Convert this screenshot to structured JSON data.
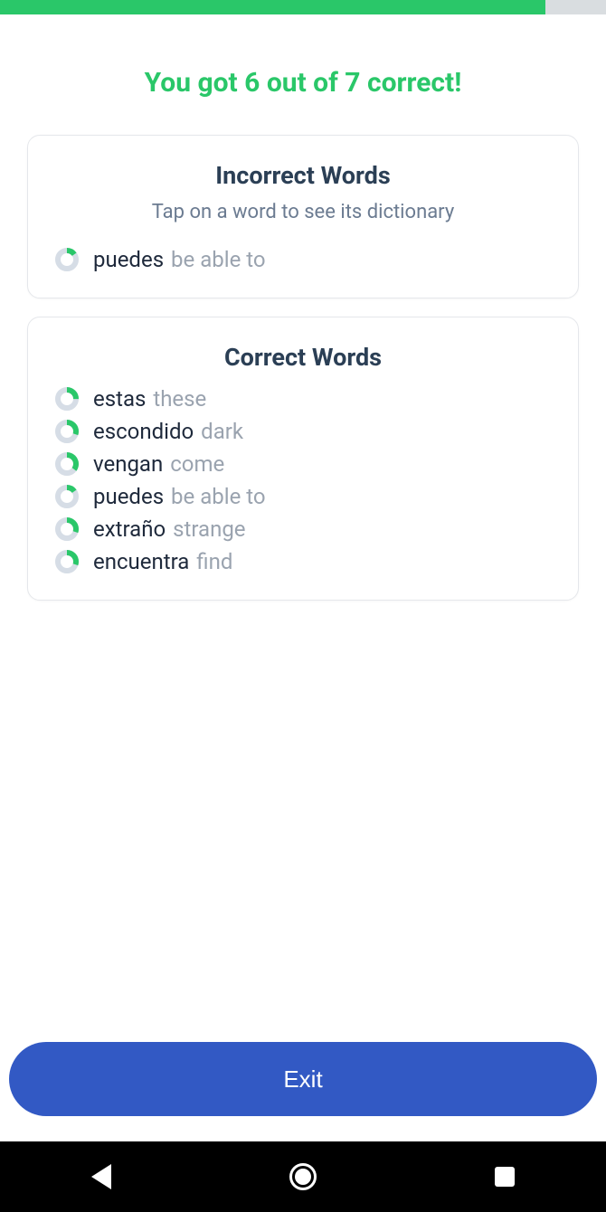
{
  "progress": {
    "percent": 90
  },
  "score": {
    "text": "You got 6 out of 7 correct!"
  },
  "incorrect": {
    "title": "Incorrect Words",
    "subtitle": "Tap on a word to see its dictionary",
    "items": [
      {
        "word": "puedes",
        "translation": "be able to",
        "ring": 15
      }
    ]
  },
  "correct": {
    "title": "Correct Words",
    "items": [
      {
        "word": "estas",
        "translation": "these",
        "ring": 25
      },
      {
        "word": "escondido",
        "translation": "dark",
        "ring": 30
      },
      {
        "word": "vengan",
        "translation": "come",
        "ring": 35
      },
      {
        "word": "puedes",
        "translation": "be able to",
        "ring": 15
      },
      {
        "word": "extraño",
        "translation": "strange",
        "ring": 30
      },
      {
        "word": "encuentra",
        "translation": "find",
        "ring": 30
      }
    ]
  },
  "exit": {
    "label": "Exit"
  },
  "colors": {
    "accent": "#2ac769",
    "ringBg": "#d6dde6",
    "button": "#3259c4"
  }
}
